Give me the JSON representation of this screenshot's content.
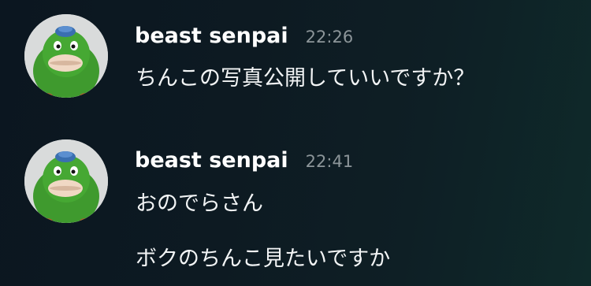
{
  "messages": [
    {
      "username": "beast senpai",
      "timestamp": "22:26",
      "lines": [
        "ちんこの写真公開していいですか？"
      ],
      "avatar_icon": "green-character-avatar"
    },
    {
      "username": "beast senpai",
      "timestamp": "22:41",
      "lines": [
        "おのでらさん",
        "ボクのちんこ見たいですか"
      ],
      "avatar_icon": "green-character-avatar"
    }
  ],
  "colors": {
    "background": "#0d1a22",
    "username": "#ffffff",
    "timestamp": "#8c9599",
    "message_text": "#f2f4f5",
    "avatar_bg": "#d9dbdb",
    "character_green": "#3f9a2e"
  }
}
